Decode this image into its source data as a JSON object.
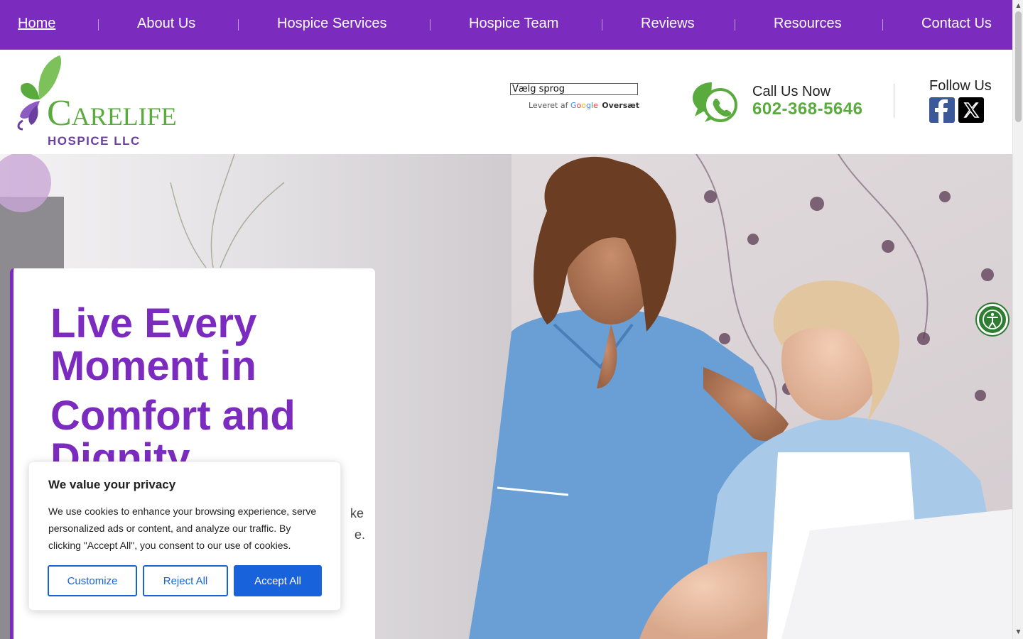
{
  "nav": {
    "items": [
      {
        "label": "Home"
      },
      {
        "label": "About Us"
      },
      {
        "label": "Hospice Services"
      },
      {
        "label": "Hospice Team"
      },
      {
        "label": "Reviews"
      },
      {
        "label": "Resources"
      },
      {
        "label": "Contact Us"
      }
    ]
  },
  "header": {
    "logo_main": "Carelife",
    "logo_sub": "HOSPICE LLC",
    "translate": {
      "select_label": "Vælg sprog",
      "powered_prefix": "Leveret af",
      "google_letters": [
        "G",
        "o",
        "o",
        "g",
        "l",
        "e"
      ],
      "translate_word": "Oversæt"
    },
    "call_label": "Call Us Now",
    "phone": "602-368-5646",
    "follow_label": "Follow Us",
    "social": [
      "facebook-icon",
      "x-icon"
    ]
  },
  "hero": {
    "title_line1": "Live Every",
    "title_line2": "Moment in",
    "title_line3": "Comfort and",
    "title_line4": "Dignity",
    "body_fragment_1": "ke",
    "body_fragment_2": "e."
  },
  "cookie": {
    "title": "We value your privacy",
    "text": "We use cookies to enhance your browsing experience, serve personalized ads or content, and analyze our traffic. By clicking \"Accept All\", you consent to our use of cookies.",
    "customize": "Customize",
    "reject": "Reject All",
    "accept": "Accept All"
  },
  "colors": {
    "brand_purple": "#7b2cbf",
    "brand_green": "#5aab3e",
    "cookie_blue": "#1863dc",
    "a11y_green": "#2e7d32"
  }
}
